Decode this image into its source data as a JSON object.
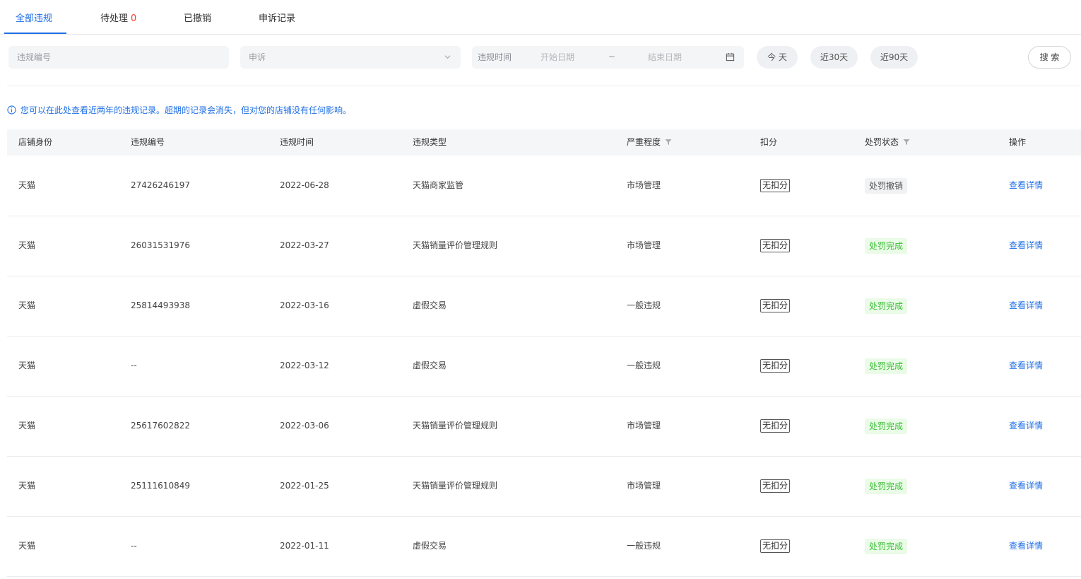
{
  "tabs": [
    {
      "label": "全部违规",
      "active": true
    },
    {
      "label": "待处理",
      "count": "0"
    },
    {
      "label": "已撤销"
    },
    {
      "label": "申诉记录"
    }
  ],
  "filters": {
    "id_placeholder": "违规编号",
    "type_value": "申诉",
    "date_label": "违规时间",
    "start_placeholder": "开始日期",
    "separator": "~",
    "end_placeholder": "结束日期",
    "quick": [
      "今 天",
      "近30天",
      "近90天"
    ],
    "search_label": "搜 索"
  },
  "notice": "您可以在此处查看近两年的违规记录。超期的记录会消失，但对您的店铺没有任何影响。",
  "table": {
    "headers": [
      "店铺身份",
      "违规编号",
      "违规时间",
      "违规类型",
      "严重程度",
      "扣分",
      "处罚状态",
      "操作"
    ],
    "rows": [
      {
        "shop": "天猫",
        "id": "27426246197",
        "date": "2022-06-28",
        "type": "天猫商家监管",
        "severity": "市场管理",
        "score": "无扣分",
        "status": "处罚撤销",
        "status_kind": "revoked",
        "action": "查看详情"
      },
      {
        "shop": "天猫",
        "id": "26031531976",
        "date": "2022-03-27",
        "type": "天猫销量评价管理规则",
        "severity": "市场管理",
        "score": "无扣分",
        "status": "处罚完成",
        "status_kind": "done",
        "action": "查看详情"
      },
      {
        "shop": "天猫",
        "id": "25814493938",
        "date": "2022-03-16",
        "type": "虚假交易",
        "severity": "一般违规",
        "score": "无扣分",
        "status": "处罚完成",
        "status_kind": "done",
        "action": "查看详情"
      },
      {
        "shop": "天猫",
        "id": "--",
        "date": "2022-03-12",
        "type": "虚假交易",
        "severity": "一般违规",
        "score": "无扣分",
        "status": "处罚完成",
        "status_kind": "done",
        "action": "查看详情"
      },
      {
        "shop": "天猫",
        "id": "25617602822",
        "date": "2022-03-06",
        "type": "天猫销量评价管理规则",
        "severity": "市场管理",
        "score": "无扣分",
        "status": "处罚完成",
        "status_kind": "done",
        "action": "查看详情"
      },
      {
        "shop": "天猫",
        "id": "25111610849",
        "date": "2022-01-25",
        "type": "天猫销量评价管理规则",
        "severity": "市场管理",
        "score": "无扣分",
        "status": "处罚完成",
        "status_kind": "done",
        "action": "查看详情"
      },
      {
        "shop": "天猫",
        "id": "--",
        "date": "2022-01-11",
        "type": "虚假交易",
        "severity": "一般违规",
        "score": "无扣分",
        "status": "处罚完成",
        "status_kind": "done",
        "action": "查看详情"
      }
    ]
  },
  "colors": {
    "accent": "#1f6fe5",
    "count": "#ff3b30",
    "done_text": "#3cbf37",
    "done_bg": "#eafbe7"
  },
  "icons": {
    "dropdown": "chevron-down-icon",
    "date": "calendar-icon",
    "info": "info-icon",
    "filter": "filter-icon"
  }
}
